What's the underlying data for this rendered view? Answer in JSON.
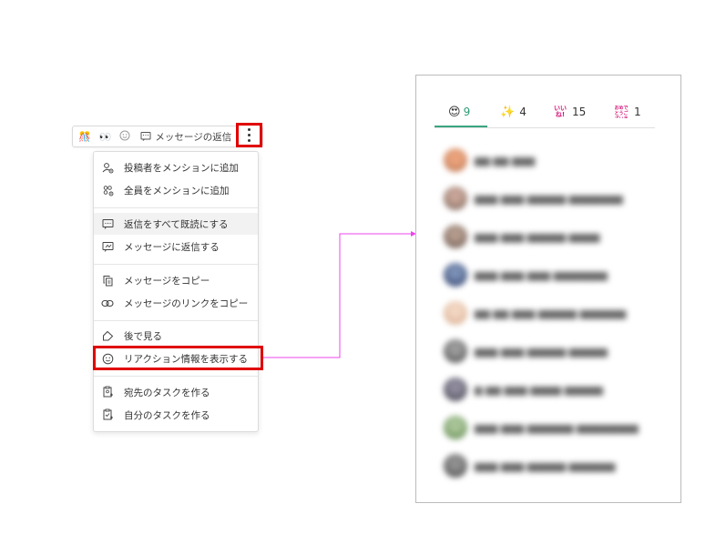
{
  "toolbar": {
    "emojis": [
      "🎊",
      "👀",
      "☺"
    ],
    "reply_label": "メッセージの返信",
    "more_icon": "vertical-ellipsis-icon"
  },
  "menu": {
    "items": [
      {
        "icon": "person-mention-icon",
        "label": "投稿者をメンションに追加"
      },
      {
        "icon": "group-mention-icon",
        "label": "全員をメンションに追加"
      },
      {
        "icon": "reply-all-icon",
        "label": "返信をすべて既読にする"
      },
      {
        "icon": "reply-message-icon",
        "label": "メッセージに返信する"
      },
      {
        "icon": "copy-icon",
        "label": "メッセージをコピー"
      },
      {
        "icon": "link-icon",
        "label": "メッセージのリンクをコピー"
      },
      {
        "icon": "tag-icon",
        "label": "後で見る"
      },
      {
        "icon": "smile-icon",
        "label": "リアクション情報を表示する"
      },
      {
        "icon": "task-to-recipient-icon",
        "label": "宛先のタスクを作る"
      },
      {
        "icon": "task-self-icon",
        "label": "自分のタスクを作る"
      }
    ]
  },
  "reactions_panel": {
    "tabs": [
      {
        "emoji": "😍",
        "count": "9"
      },
      {
        "emoji": "✨",
        "count": "4"
      },
      {
        "emoji": "いいね!",
        "count": "15"
      },
      {
        "emoji": "おめでとうございます",
        "count": "1"
      }
    ]
  },
  "colors": {
    "highlight_red": "#e00000",
    "connector_magenta": "#ee44ee",
    "active_tab_green": "#2e9b75"
  }
}
